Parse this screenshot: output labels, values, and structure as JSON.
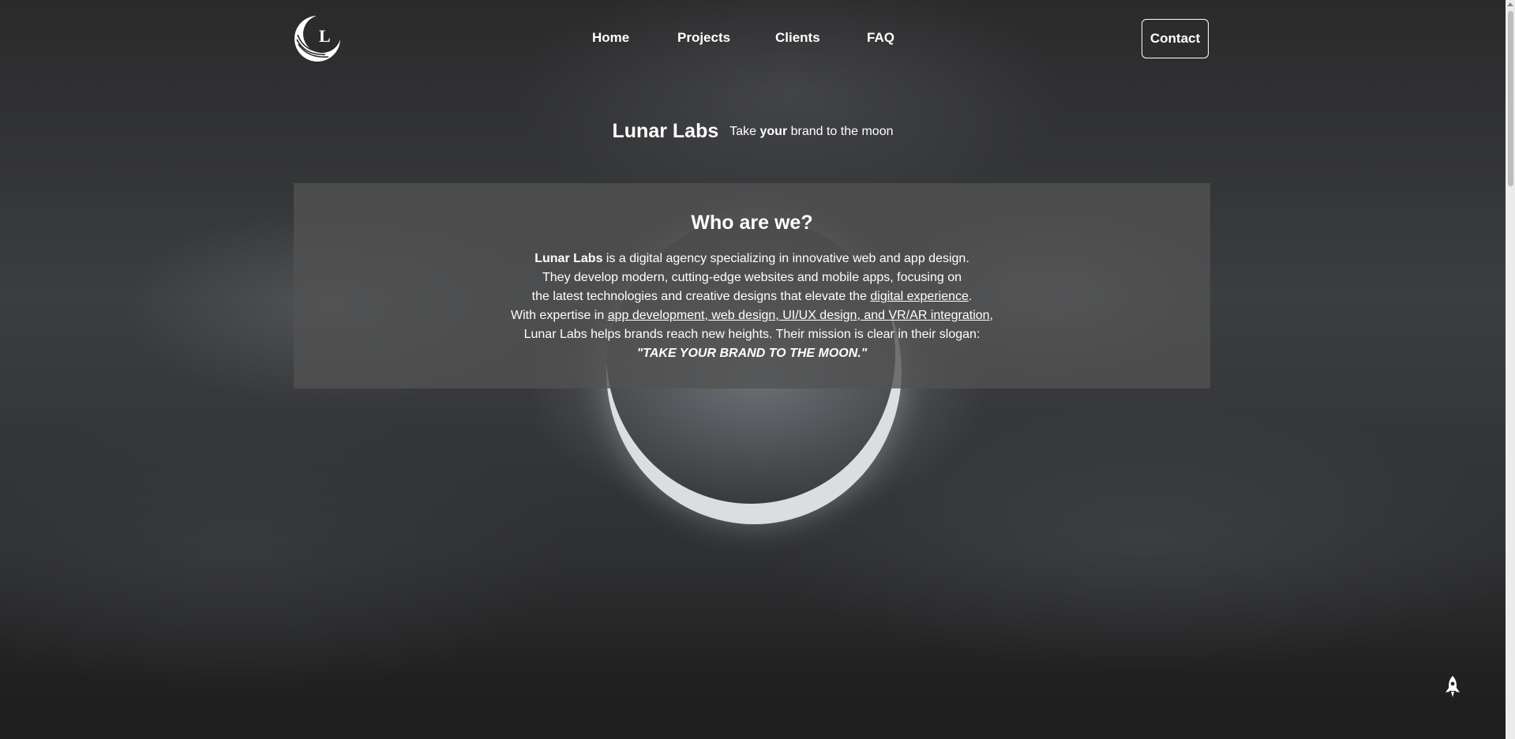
{
  "nav": {
    "items": [
      {
        "label": "Home"
      },
      {
        "label": "Projects"
      },
      {
        "label": "Clients"
      },
      {
        "label": "FAQ"
      }
    ],
    "contact_label": "Contact"
  },
  "logo": {
    "icon": "lunar-labs-logo-icon",
    "letter": "L"
  },
  "hero": {
    "brand": "Lunar Labs",
    "tagline_pre": "Take ",
    "tagline_bold": "your",
    "tagline_post": " brand to the moon"
  },
  "about": {
    "title": "Who are we?",
    "l1_bold": "Lunar Labs",
    "l1_rest": " is a digital agency specializing in innovative web and app design.",
    "l2": "They develop modern, cutting-edge websites and mobile apps, focusing on",
    "l3_pre": "the latest technologies and creative designs that elevate the ",
    "l3_link": "digital experience",
    "l3_post": ".",
    "l4_pre": "With expertise in ",
    "l4_link": "app development, web design, UI/UX design, and VR/AR integration",
    "l4_post": ",",
    "l5": "Lunar Labs helps brands reach new heights. Their mission is clear in their slogan:",
    "slogan": "\"TAKE YOUR BRAND TO THE MOON.\""
  },
  "scroll_top": {
    "icon": "rocket-icon"
  },
  "colors": {
    "text": "#ffffff",
    "panel": "#525252",
    "background": "#222222"
  }
}
